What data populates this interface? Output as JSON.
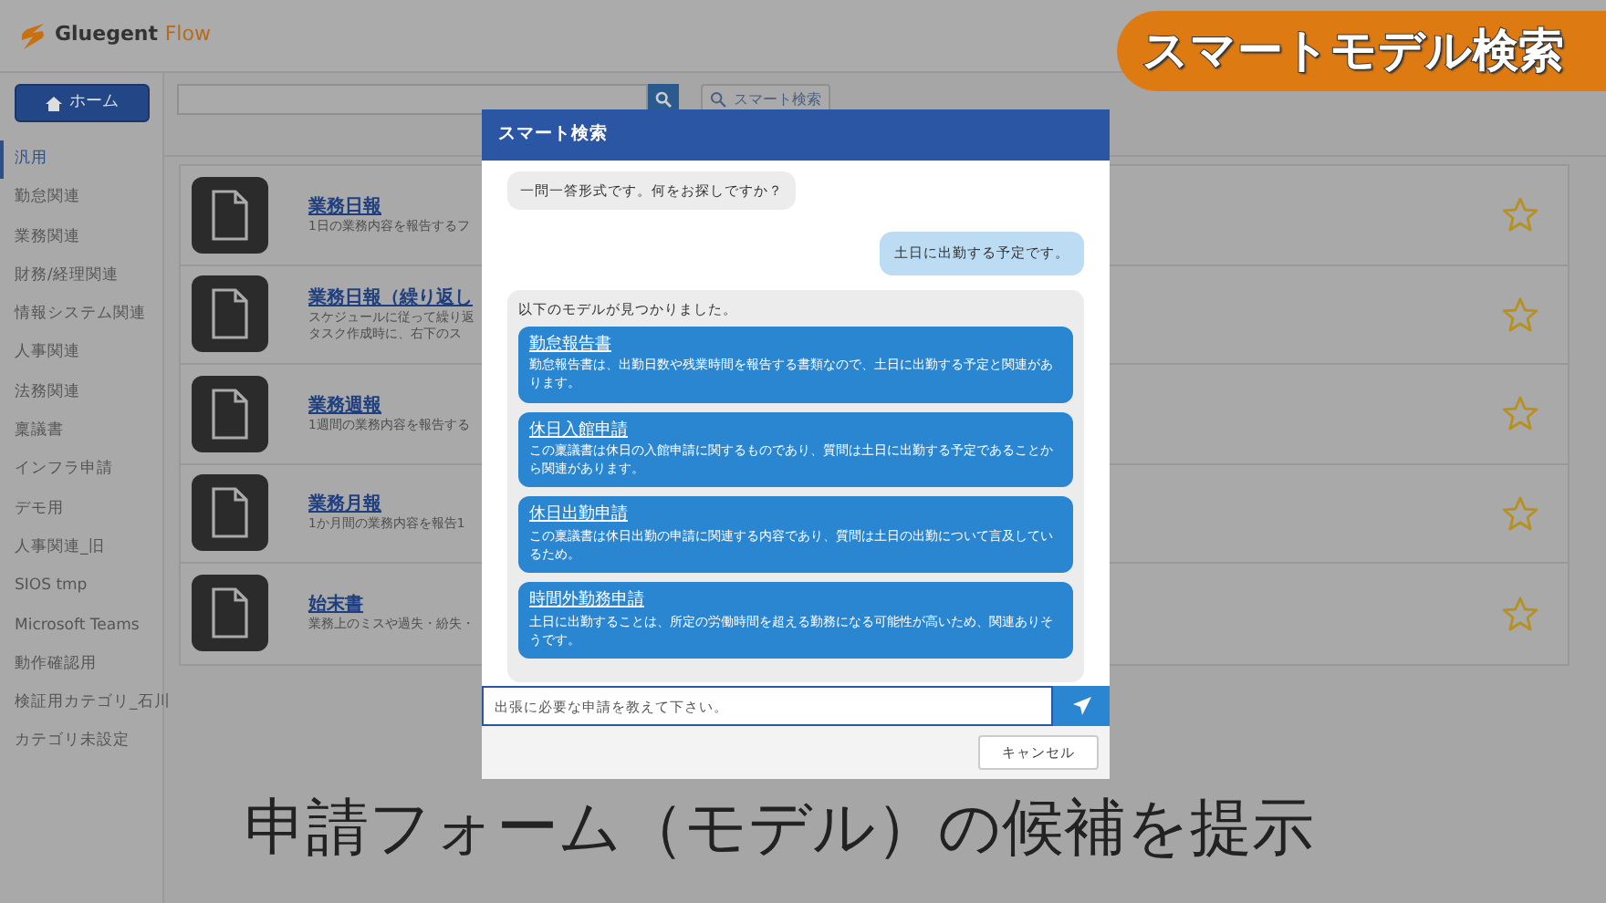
{
  "logo": {
    "name": "Gluegent",
    "product": "Flow"
  },
  "sidebar": {
    "home_button": "ホーム",
    "categories": [
      {
        "label": "汎用",
        "selected": true
      },
      {
        "label": "勤怠関連",
        "selected": false
      },
      {
        "label": "業務関連",
        "selected": false
      },
      {
        "label": "財務/経理関連",
        "selected": false
      },
      {
        "label": "情報システム関連",
        "selected": false
      },
      {
        "label": "人事関連",
        "selected": false
      },
      {
        "label": "法務関連",
        "selected": false
      },
      {
        "label": "稟議書",
        "selected": false
      },
      {
        "label": "インフラ申請",
        "selected": false
      },
      {
        "label": "デモ用",
        "selected": false
      },
      {
        "label": "人事関連_旧",
        "selected": false
      },
      {
        "label": "SIOS tmp",
        "selected": false
      },
      {
        "label": "Microsoft Teams",
        "selected": false
      },
      {
        "label": "動作確認用",
        "selected": false
      },
      {
        "label": "検証用カテゴリ_石川",
        "selected": false
      },
      {
        "label": "カテゴリ未設定",
        "selected": false
      }
    ]
  },
  "toolbar": {
    "smart_search_button": "スマート検索"
  },
  "models": [
    {
      "title": "業務日報",
      "description": [
        "1日の業務内容を報告するフ"
      ],
      "favorite": false
    },
    {
      "title": "業務日報（繰り返し",
      "description": [
        "スケジュールに従って繰り返",
        "タスク作成時に、右下のス"
      ],
      "favorite": false
    },
    {
      "title": "業務週報",
      "description": [
        "1週間の業務内容を報告する"
      ],
      "favorite": false
    },
    {
      "title": "業務月報",
      "description": [
        "1か月間の業務内容を報告1"
      ],
      "favorite": false
    },
    {
      "title": "始末書",
      "description": [
        "業務上のミスや過失・紛失・"
      ],
      "favorite": false
    }
  ],
  "dialog": {
    "title": "スマート検索",
    "messages": [
      {
        "kind": "bot",
        "text": "一問一答形式です。何をお探しですか？"
      },
      {
        "kind": "user",
        "text": "土日に出勤する予定です。"
      },
      {
        "kind": "results",
        "text": "以下のモデルが見つかりました。",
        "results": [
          {
            "title": "勤怠報告書",
            "text": "勤怠報告書は、出勤日数や残業時間を報告する書類なので、土日に出勤する予定と関連があります。"
          },
          {
            "title": "休日入館申請",
            "text": "この稟議書は休日の入館申請に関するものであり、質問は土日に出勤する予定であることから関連があります。"
          },
          {
            "title": "休日出勤申請",
            "text": "この稟議書は休日出勤の申請に関連する内容であり、質問は土日の出勤について言及しているため。"
          },
          {
            "title": "時間外勤務申請",
            "text": "土日に出勤することは、所定の労働時間を超える勤務になる可能性が高いため、関連ありそうです。"
          }
        ]
      }
    ],
    "input": {
      "placeholder": "出張に必要な申請を教えて下さい。"
    },
    "cancel_button": "キャンセル"
  },
  "overlay": {
    "badge": "スマートモデル検索",
    "caption": "申請フォーム（モデル）の候補を提示"
  }
}
